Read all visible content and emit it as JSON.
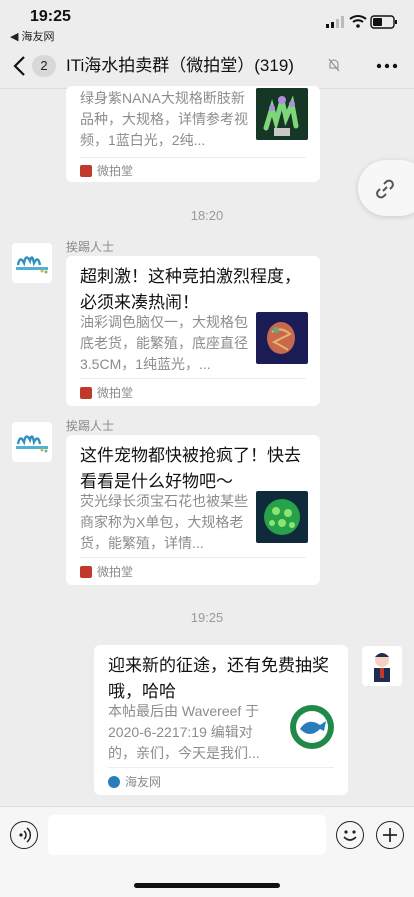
{
  "status_bar": {
    "time": "19:25",
    "back_app": "◀ 海友网"
  },
  "nav": {
    "unread_count": "2",
    "title": "ITi海水拍卖群（微拍堂）(319)"
  },
  "messages": [
    {
      "desc": "绿身紫NANA大规格断肢新品种，大规格，详情参考视频，1蓝白光，2纯...",
      "source": "微拍堂"
    },
    {
      "timestamp": "18:20"
    },
    {
      "sender": "挨踢人士",
      "title": "超刺激！这种竞拍激烈程度，必须来凑热闹！",
      "desc": "油彩调色脑仅一，大规格包底老货，能繁殖，底座直径3.5CM，1纯蓝光，...",
      "source": "微拍堂"
    },
    {
      "sender": "挨踢人士",
      "title": "这件宠物都快被抢疯了！快去看看是什么好物吧～",
      "desc": "荧光绿长须宝石花也被某些商家称为X单包，大规格老货，能繁殖，详情...",
      "source": "微拍堂"
    },
    {
      "timestamp": "19:25"
    },
    {
      "title": "迎来新的征途，还有免费抽奖哦，哈哈",
      "desc": "本帖最后由 Wavereef 于 2020-6-2217:19 编辑对的，亲们，今天是我们...",
      "source": "海友网"
    }
  ],
  "colors": {
    "background": "#ededed",
    "card": "#ffffff",
    "weipaitang_icon": "#c0392b",
    "haiyou_icon": "#2a7dbb"
  }
}
